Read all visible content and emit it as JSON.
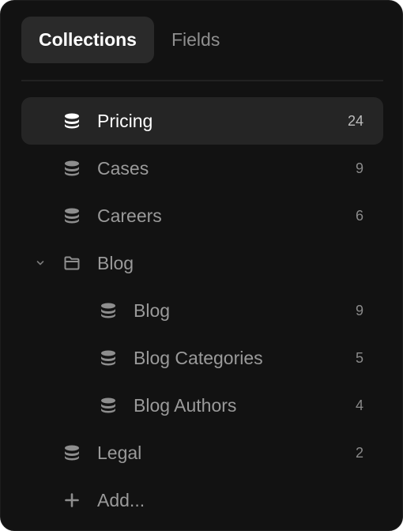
{
  "tabs": [
    {
      "label": "Collections",
      "active": true
    },
    {
      "label": "Fields",
      "active": false
    }
  ],
  "items": [
    {
      "label": "Pricing",
      "count": "24",
      "icon": "database-icon",
      "selected": true
    },
    {
      "label": "Cases",
      "count": "9",
      "icon": "database-icon"
    },
    {
      "label": "Careers",
      "count": "6",
      "icon": "database-icon"
    },
    {
      "label": "Blog",
      "icon": "folder-icon",
      "expanded": true
    },
    {
      "label": "Blog",
      "count": "9",
      "icon": "database-icon"
    },
    {
      "label": "Blog Categories",
      "count": "5",
      "icon": "database-icon"
    },
    {
      "label": "Blog Authors",
      "count": "4",
      "icon": "database-icon"
    },
    {
      "label": "Legal",
      "count": "2",
      "icon": "database-icon"
    }
  ],
  "add_label": "Add...",
  "colors": {
    "background": "#121212",
    "selected_row": "#252525",
    "active_tab": "#2a2a2a",
    "text_primary": "#ffffff",
    "text_secondary": "#9a9a9a"
  }
}
